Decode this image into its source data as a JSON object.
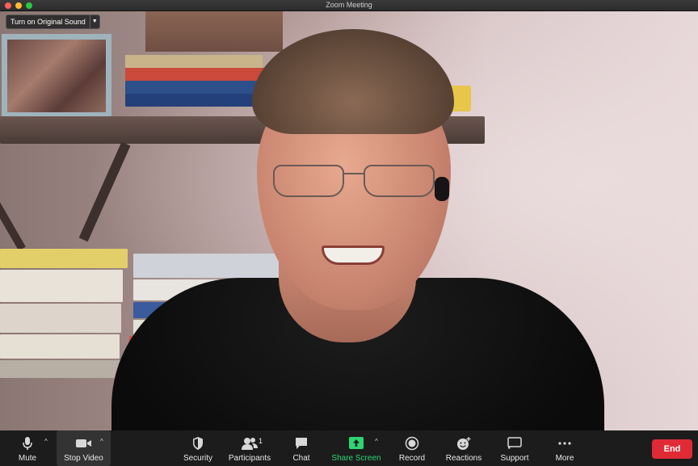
{
  "window": {
    "title": "Zoom Meeting"
  },
  "original_sound": {
    "label": "Turn on Original Sound"
  },
  "toolbar": {
    "mute": "Mute",
    "stop_video": "Stop Video",
    "security": "Security",
    "participants": "Participants",
    "participants_count": "1",
    "chat": "Chat",
    "share_screen": "Share Screen",
    "record": "Record",
    "reactions": "Reactions",
    "support": "Support",
    "more": "More",
    "end": "End"
  },
  "colors": {
    "end_button": "#e02b36",
    "share_screen_accent": "#2ed573",
    "toolbar_bg": "#1c1c1c"
  }
}
